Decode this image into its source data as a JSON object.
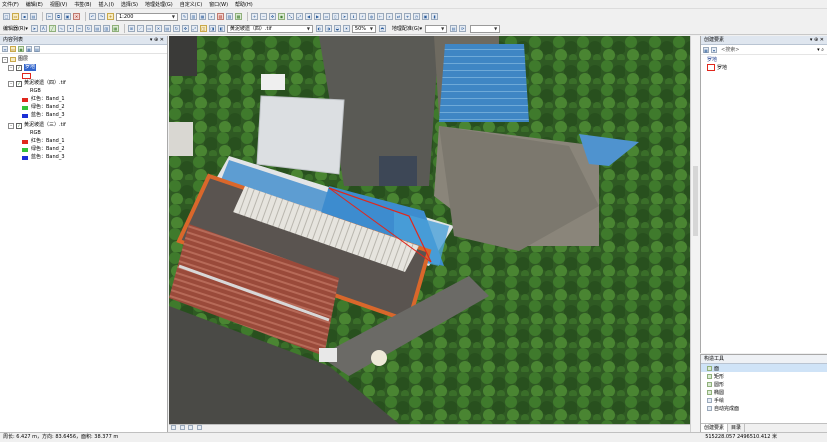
{
  "menu": [
    "文件(F)",
    "编辑(E)",
    "视图(V)",
    "书签(B)",
    "插入(I)",
    "选择(S)",
    "地理处理(G)",
    "自定义(C)",
    "窗口(W)",
    "帮助(H)"
  ],
  "toolbar": {
    "scale_value": "1:200",
    "editor_label": "编辑器(R)▾",
    "layer_label": "黄泥坡遗（四）.tif",
    "zoom_value": "50%",
    "georef_label": "地理配准(G)▾"
  },
  "toc": {
    "title": "内容列表",
    "layers_root": "图层",
    "layer_luodi": "罗地",
    "layer_four": "黄泥坡遗（四）.tif",
    "layer_three": "黄泥坡遗（三）.tif",
    "rgb": "RGB",
    "band_red": "红色：Band_1",
    "band_green": "绿色：Band_2",
    "band_blue": "蓝色：Band_3",
    "colors": {
      "red": "#e0271c",
      "green": "#35c13a",
      "blue": "#1b2fd6"
    }
  },
  "create_panel": {
    "title": "创建要素",
    "search_placeholder": "<搜索>",
    "group_label": "罗地",
    "item_label": "罗地"
  },
  "construct_panel": {
    "title": "构造工具",
    "tools": [
      "面",
      "矩形",
      "圆形",
      "椭圆",
      "手绘",
      "自动完成面"
    ]
  },
  "tabs": [
    "创建要素",
    "目录"
  ],
  "status": {
    "left": "周长: 6.427 m，方向: 83.6456，面积: 38.377 m",
    "right": "515228.057  2496510.412 米"
  }
}
